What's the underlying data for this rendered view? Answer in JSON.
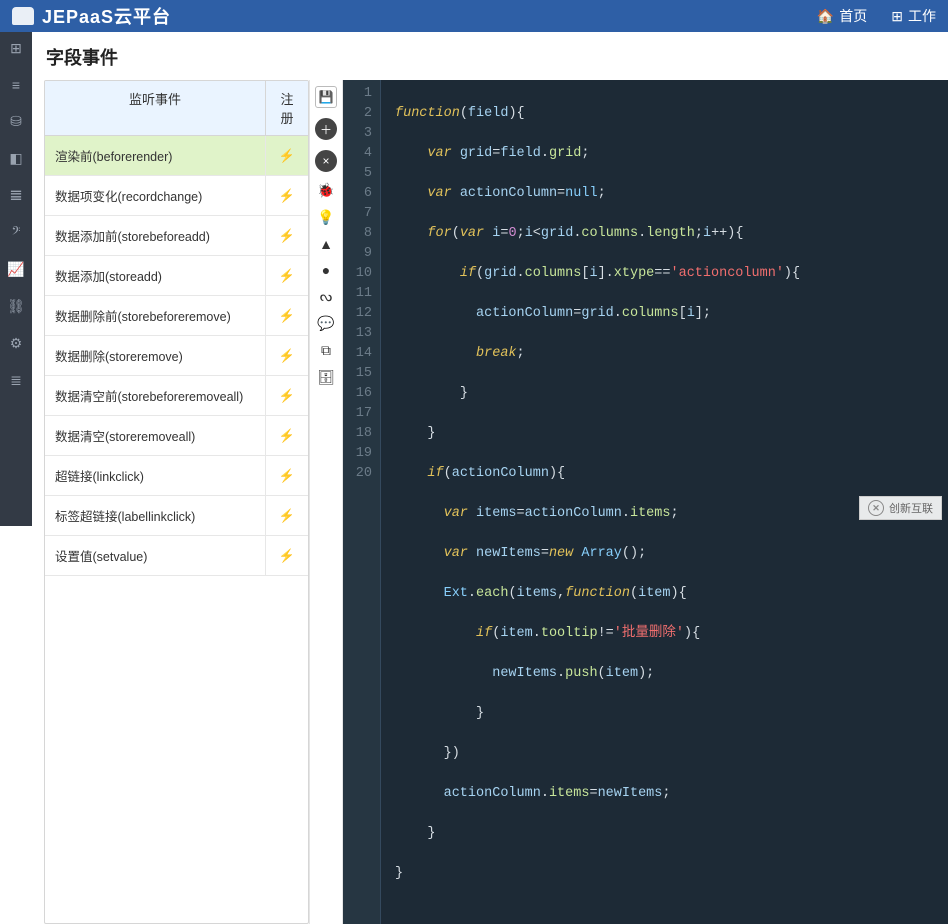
{
  "topbar": {
    "brand": "JEPaaS云平台",
    "nav_home": "首页",
    "nav_work": "工作"
  },
  "leftnav": {
    "items": [
      "⊞",
      "≡",
      "⛁",
      "◧",
      "𝌆",
      "𝄢",
      "📈",
      "⛓",
      "⚙",
      "≣"
    ]
  },
  "page": {
    "title": "字段事件"
  },
  "eventPanel": {
    "header_main": "监听事件",
    "header_reg": "注册",
    "rows": [
      {
        "label": "渲染前(beforerender)",
        "hot": true,
        "selected": true
      },
      {
        "label": "数据项变化(recordchange)",
        "hot": false
      },
      {
        "label": "数据添加前(storebeforeadd)",
        "hot": false
      },
      {
        "label": "数据添加(storeadd)",
        "hot": false
      },
      {
        "label": "数据删除前(storebeforeremove)",
        "hot": false
      },
      {
        "label": "数据删除(storeremove)",
        "hot": false
      },
      {
        "label": "数据清空前(storebeforeremoveall)",
        "hot": false
      },
      {
        "label": "数据清空(storeremoveall)",
        "hot": false
      },
      {
        "label": "超链接(linkclick)",
        "hot": false
      },
      {
        "label": "标签超链接(labellinkclick)",
        "hot": false
      },
      {
        "label": "设置值(setvalue)",
        "hot": false
      }
    ]
  },
  "toolstrip": [
    "💾",
    "＋",
    "×",
    "🐞",
    "💡",
    "▲",
    "●",
    "ᔓ",
    "💬",
    "⧉",
    "🗄"
  ],
  "code": {
    "lines": 20,
    "string_literals": {
      "actioncolumn": "'actioncolumn'",
      "batch_delete": "'批量删除'"
    }
  },
  "watermark": {
    "label": "创新互联"
  }
}
